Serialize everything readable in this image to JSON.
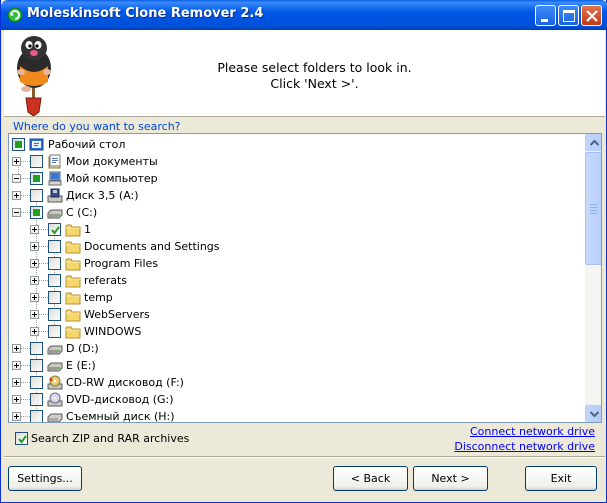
{
  "window": {
    "title": "Moleskinsoft Clone Remover 2.4",
    "controls": {
      "minimize": "minimize",
      "maximize": "maximize",
      "close": "close"
    }
  },
  "header": {
    "line1": "Please select folders to look in.",
    "line2": "Click 'Next >'."
  },
  "search": {
    "label": "Where do you want to search?"
  },
  "tree": {
    "items": [
      {
        "label": "Рабочий стол",
        "icon": "desktop-icon",
        "check": "partial",
        "expander": "none"
      },
      {
        "label": "Мои документы",
        "icon": "my-documents-icon",
        "check": "unchecked",
        "expander": "plus"
      },
      {
        "label": "Мой компьютер",
        "icon": "my-computer-icon",
        "check": "partial",
        "expander": "minus"
      },
      {
        "label": "Диск 3,5 (A:)",
        "icon": "floppy-drive-icon",
        "check": "unchecked",
        "expander": "plus"
      },
      {
        "label": "C (C:)",
        "icon": "hard-drive-icon",
        "check": "partial",
        "expander": "minus"
      },
      {
        "label": "1",
        "icon": "folder-icon",
        "check": "checked",
        "expander": "plus"
      },
      {
        "label": "Documents and Settings",
        "icon": "folder-icon",
        "check": "unchecked",
        "expander": "plus"
      },
      {
        "label": "Program Files",
        "icon": "folder-icon",
        "check": "unchecked",
        "expander": "plus"
      },
      {
        "label": "referats",
        "icon": "folder-icon",
        "check": "unchecked",
        "expander": "plus"
      },
      {
        "label": "temp",
        "icon": "folder-icon",
        "check": "unchecked",
        "expander": "plus"
      },
      {
        "label": "WebServers",
        "icon": "folder-icon",
        "check": "unchecked",
        "expander": "plus"
      },
      {
        "label": "WINDOWS",
        "icon": "folder-icon",
        "check": "unchecked",
        "expander": "plus"
      },
      {
        "label": "D (D:)",
        "icon": "hard-drive-icon",
        "check": "unchecked",
        "expander": "plus"
      },
      {
        "label": "E (E:)",
        "icon": "hard-drive-icon",
        "check": "unchecked",
        "expander": "plus"
      },
      {
        "label": "CD-RW дисковод (F:)",
        "icon": "cd-drive-icon",
        "check": "unchecked",
        "expander": "plus"
      },
      {
        "label": "DVD-дисковод (G:)",
        "icon": "dvd-drive-icon",
        "check": "unchecked",
        "expander": "plus"
      },
      {
        "label": "Съемный диск (H:)",
        "icon": "removable-drive-icon",
        "check": "unchecked",
        "expander": "plus"
      }
    ]
  },
  "options": {
    "zip_label": "Search ZIP and RAR archives",
    "zip_checked": true
  },
  "links": {
    "connect": "Connect network drive",
    "disconnect": "Disconnect network drive"
  },
  "buttons": {
    "settings": "Settings...",
    "back": "< Back",
    "next": "Next >",
    "exit": "Exit"
  },
  "colors": {
    "titlebar": "#0058E6",
    "window_bg": "#ECE9D8",
    "link": "#0000FF",
    "check_green": "#21A121"
  }
}
